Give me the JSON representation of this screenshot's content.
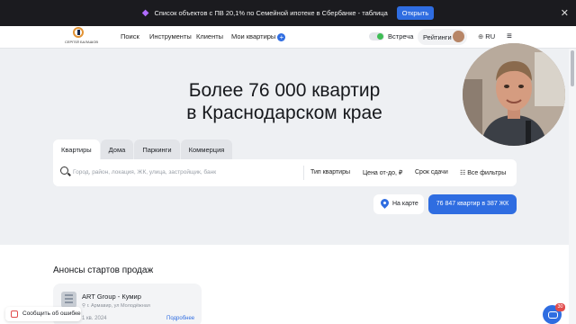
{
  "banner": {
    "text": "Список объектов с ПВ 20,1% по Семейной ипотеке в Сбербанке - таблица",
    "button": "Открыть",
    "close": "✕"
  },
  "header": {
    "logo_text": "СЕРГЕЙ БАЛАШОВ",
    "nav": [
      "Поиск",
      "Инструменты",
      "Клиенты",
      "Мои квартиры"
    ],
    "my_flats_plus": "+",
    "meeting_label": "Встреча",
    "meeting_on": true,
    "rating_label": "Рейтинги",
    "lang": "RU",
    "lang_icon": "globe-icon",
    "menu_icon": "≡"
  },
  "hero": {
    "title_line1": "Более 76 000 квартир",
    "title_line2": "в Краснодарском крае",
    "tabs": [
      "Квартиры",
      "Дома",
      "Паркинги",
      "Коммерция"
    ],
    "active_tab": 0,
    "search_placeholder": "Город, район, локация, ЖК, улица, застройщик, банк",
    "filters": [
      "Тип квартиры",
      "Цена от-до, ₽",
      "Срок сдачи",
      "Все фильтры"
    ],
    "map_button": "На карте",
    "show_button": "76 847 квартир в 387 ЖК"
  },
  "announcements": {
    "title": "Анонсы стартов продаж",
    "card": {
      "name": "ART Group - Кумир",
      "address": "г. Армавир, ул Молодёжная",
      "date": "1 кв. 2024",
      "more": "Подробнее"
    }
  },
  "report_error": "Сообщить об ошибке",
  "chat_badge": "30",
  "colors": {
    "accent": "#2f6de1",
    "toggle_on": "#3ebd55",
    "badge": "#e14c4c",
    "banner_bg": "#1b1b1f"
  }
}
